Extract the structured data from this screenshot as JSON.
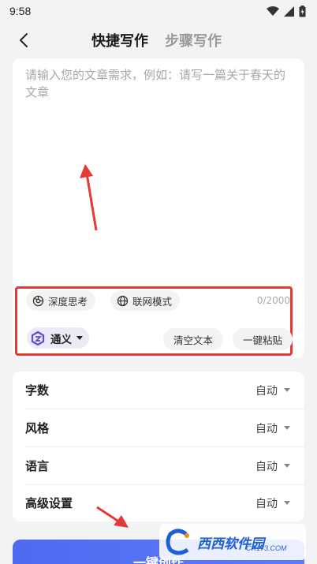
{
  "status_bar": {
    "time": "9:58",
    "icons": [
      "wifi-icon",
      "signal-icon",
      "battery-icon"
    ]
  },
  "nav": {
    "back_icon": "chevron-left-icon",
    "tabs": [
      {
        "label": "快捷写作",
        "active": true
      },
      {
        "label": "步骤写作",
        "active": false
      }
    ]
  },
  "editor": {
    "placeholder": "请输入您的文章需求，例如：请写一篇关于春天的文章",
    "value": ""
  },
  "toolbar": {
    "deep_think_label": "深度思考",
    "web_mode_label": "联网模式",
    "char_count": "0/2000",
    "model_label": "通义",
    "clear_label": "清空文本",
    "paste_label": "一键粘贴"
  },
  "settings": [
    {
      "label": "字数",
      "value": "自动"
    },
    {
      "label": "风格",
      "value": "自动"
    },
    {
      "label": "语言",
      "value": "自动"
    },
    {
      "label": "高级设置",
      "value": "自动"
    }
  ],
  "submit": {
    "label": "一键创作"
  },
  "watermark": {
    "brand": "西西软件园",
    "site": "CR173.COM"
  },
  "colors": {
    "accent": "#5370f2",
    "annotation_red": "#e53935",
    "background": "#f2f3f5"
  }
}
